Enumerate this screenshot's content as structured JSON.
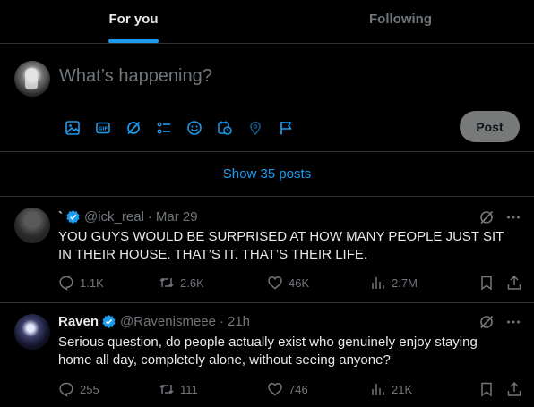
{
  "tabs": [
    {
      "label": "For you",
      "active": true
    },
    {
      "label": "Following",
      "active": false
    }
  ],
  "composer": {
    "placeholder": "What’s happening?",
    "post_label": "Post",
    "tools": [
      "image-icon",
      "gif-icon",
      "grok-icon",
      "poll-icon",
      "emoji-icon",
      "schedule-icon",
      "location-icon",
      "flag-icon"
    ],
    "gif_text": "GIF"
  },
  "show_posts": "Show 35 posts",
  "posts": [
    {
      "name": "`",
      "handle": "@ick_real",
      "time": "Mar 29",
      "text": "YOU GUYS WOULD BE SURPRISED AT HOW MANY PEOPLE JUST SIT IN THEIR HOUSE. THAT’S IT. THAT’S THEIR LIFE.",
      "replies": "1.1K",
      "reposts": "2.6K",
      "likes": "46K",
      "views": "2.7M"
    },
    {
      "name": "Raven",
      "handle": "@Ravenismeee",
      "time": "21h",
      "text": "Serious question, do people actually exist who genuinely enjoy staying home all day, completely alone, without seeing anyone?",
      "replies": "255",
      "reposts": "111",
      "likes": "746",
      "views": "21K"
    }
  ],
  "colors": {
    "accent": "#1d9bf0",
    "muted": "#71767b",
    "divider": "#2f3336",
    "background": "#000000",
    "text": "#e7e9ea"
  }
}
